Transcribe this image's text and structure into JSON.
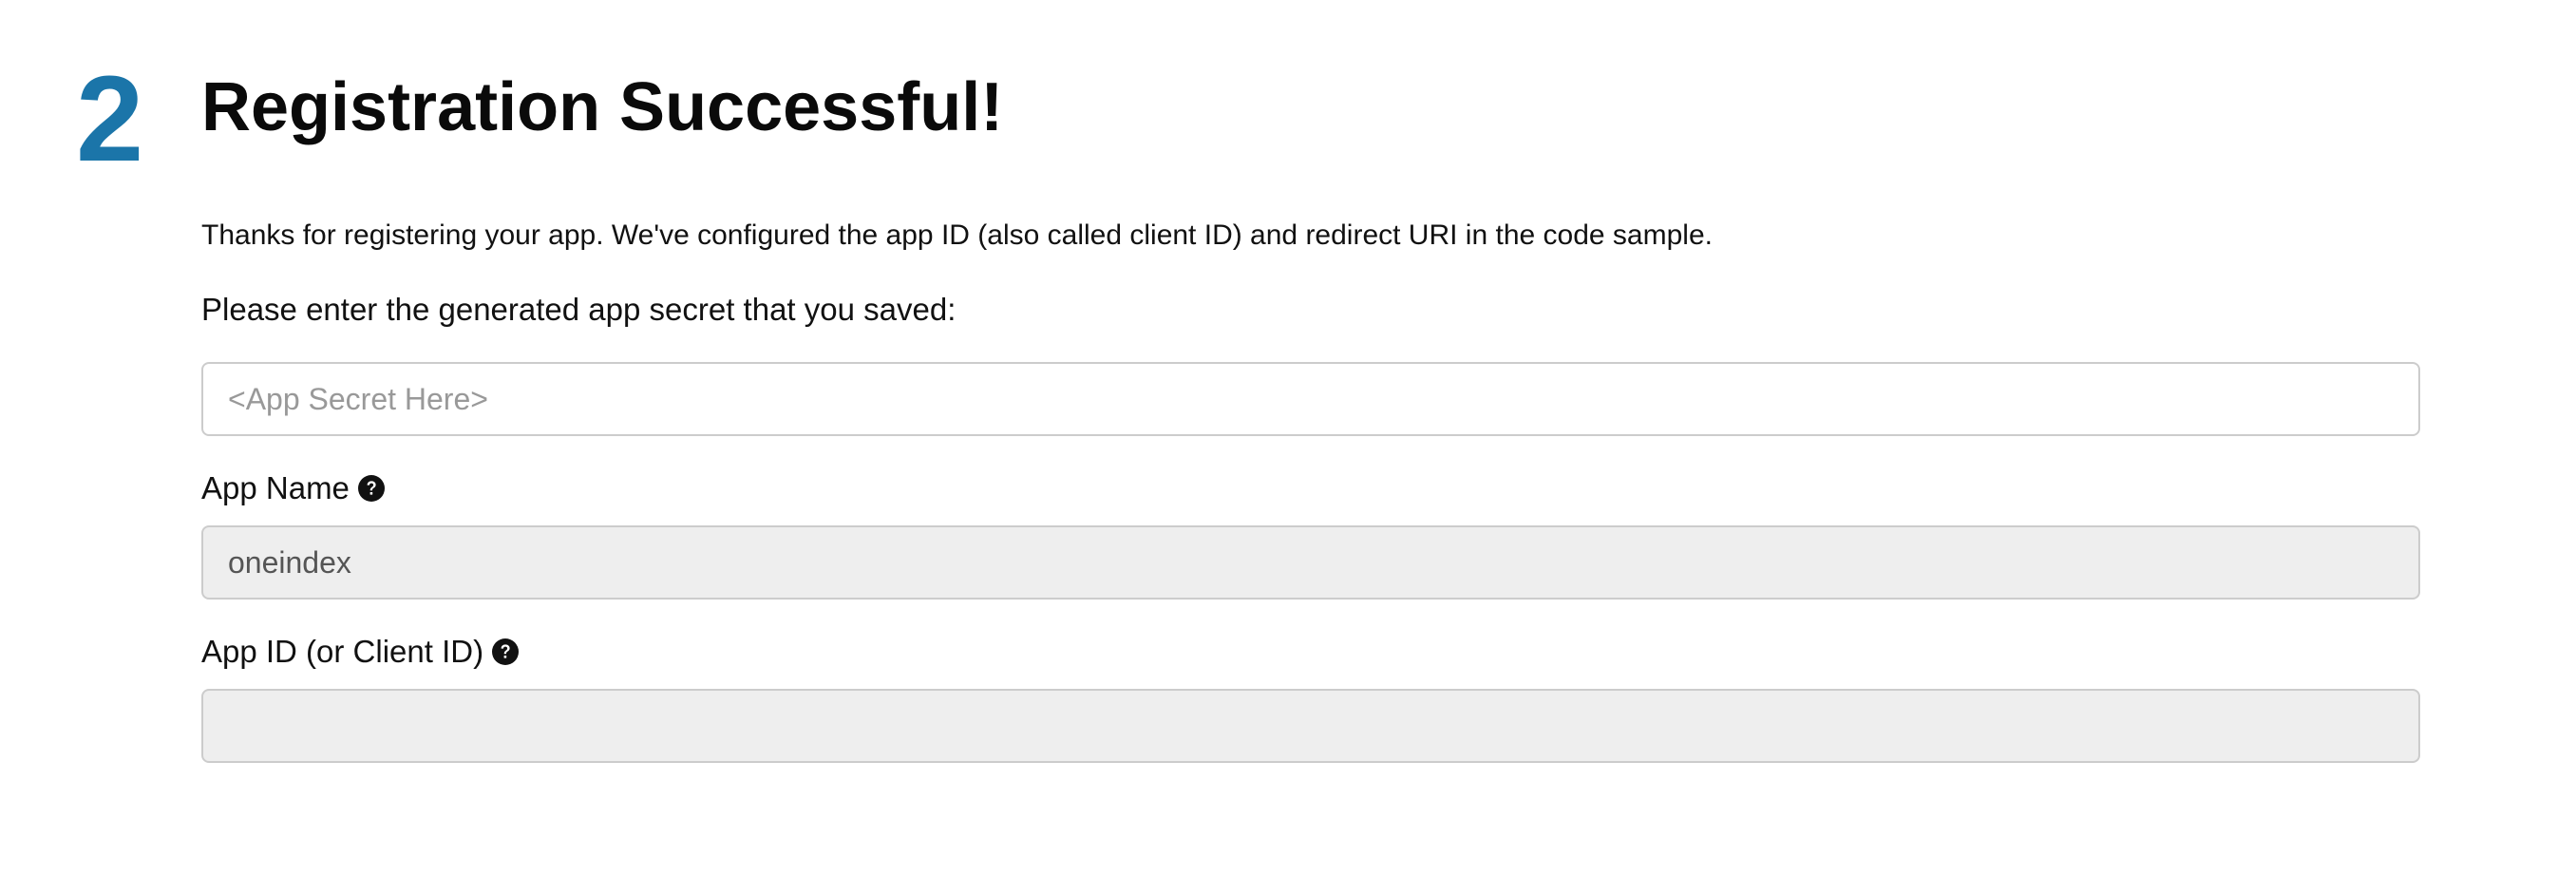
{
  "step": {
    "number": "2"
  },
  "header": {
    "title": "Registration Successful!"
  },
  "intro_text": "Thanks for registering your app. We've configured the app ID (also called client ID) and redirect URI in the code sample.",
  "secret": {
    "prompt": "Please enter the generated app secret that you saved:",
    "placeholder": "<App Secret Here>",
    "value": ""
  },
  "app_name": {
    "label": "App Name",
    "value": "oneindex",
    "help_icon": "question-circle-icon"
  },
  "app_id": {
    "label": "App ID (or Client ID)",
    "value": "",
    "help_icon": "question-circle-icon"
  },
  "colors": {
    "step_number": "#1b75a9",
    "readonly_background": "#eeeeee",
    "border": "#cccccc"
  }
}
